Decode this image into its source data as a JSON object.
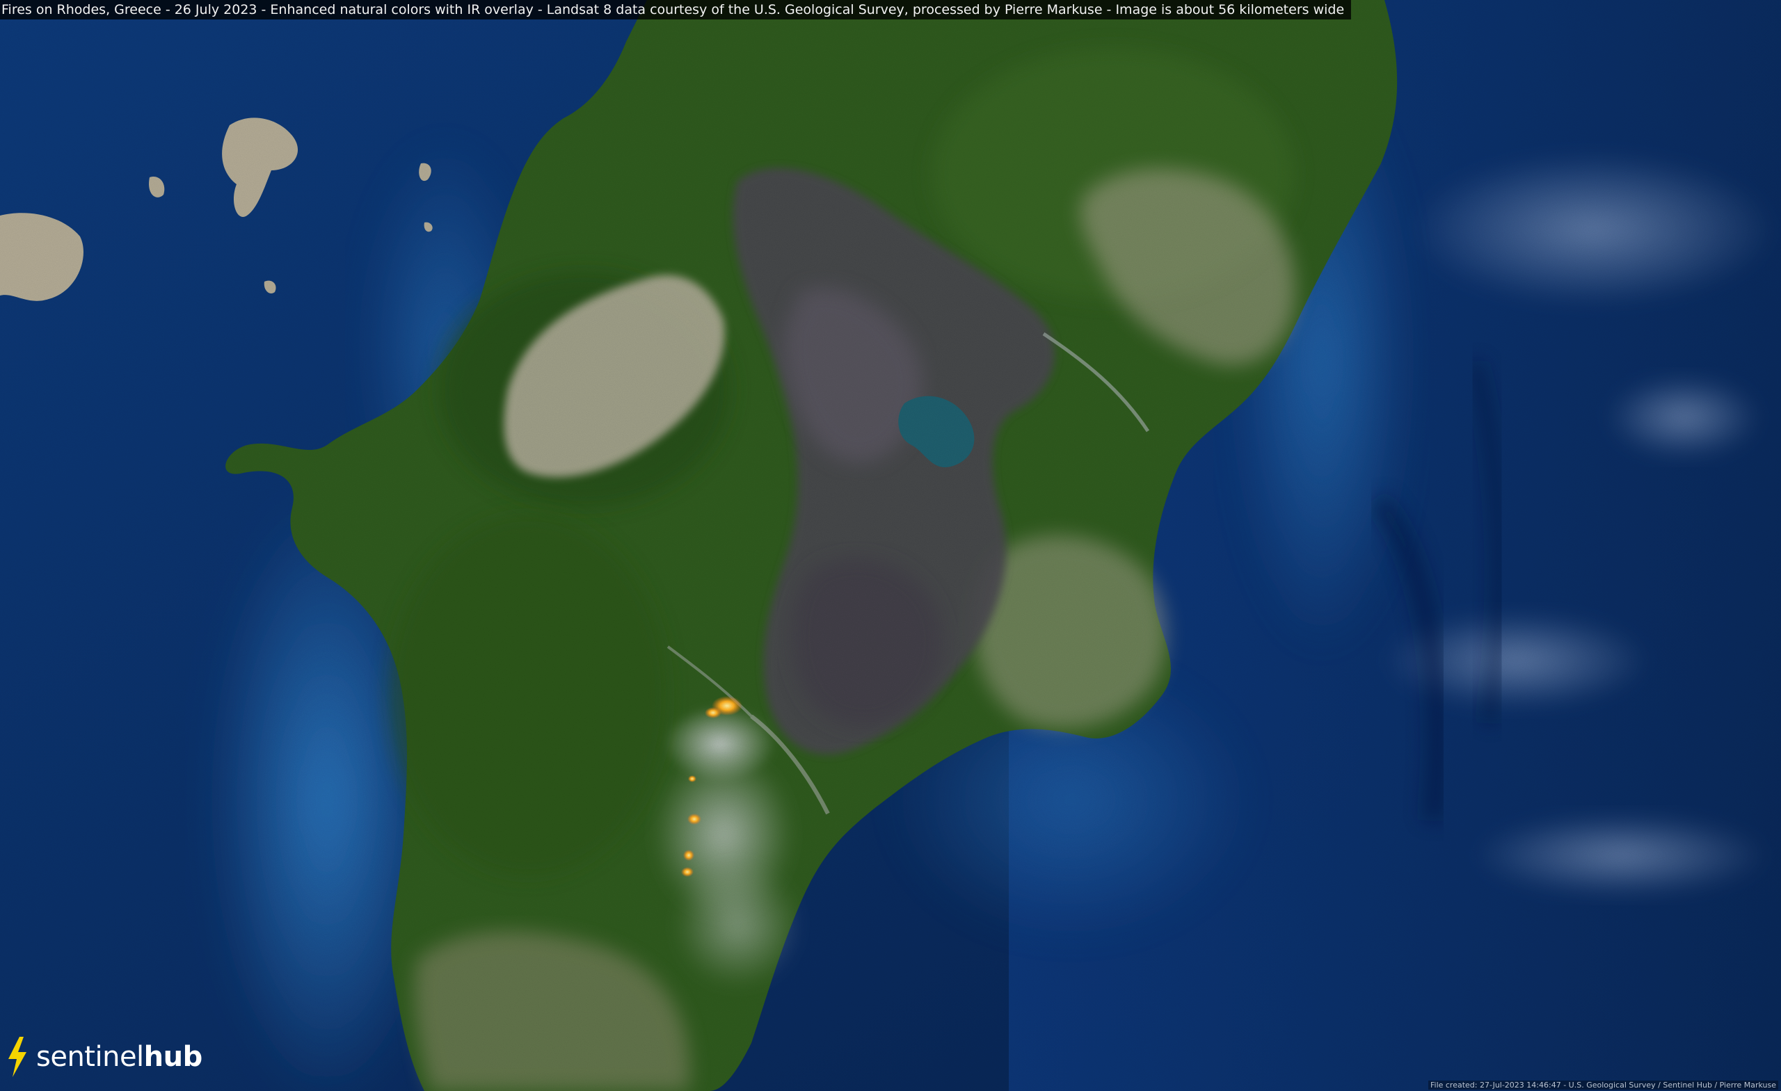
{
  "caption": "Fires on Rhodes, Greece - 26 July 2023 - Enhanced natural colors with IR overlay - Landsat 8 data courtesy of the U.S. Geological Survey, processed by Pierre Markuse - Image is about 56 kilometers wide",
  "brand": {
    "part1": "sentinel",
    "part2": "hub",
    "accent_color": "#f5d400"
  },
  "credit": "File created: 27-Jul-2023 14:46:47 - U.S. Geological Survey / Sentinel Hub / Pierre Markuse",
  "colors": {
    "sea_deep": "#0b2a5a",
    "sea_coast": "#2a6fb8",
    "land_forest": "#2f5a1e",
    "land_burned": "#4a4650",
    "land_bare": "#b5ae9c",
    "fire": "#ffb020",
    "smoke": "#c9cdd3"
  }
}
